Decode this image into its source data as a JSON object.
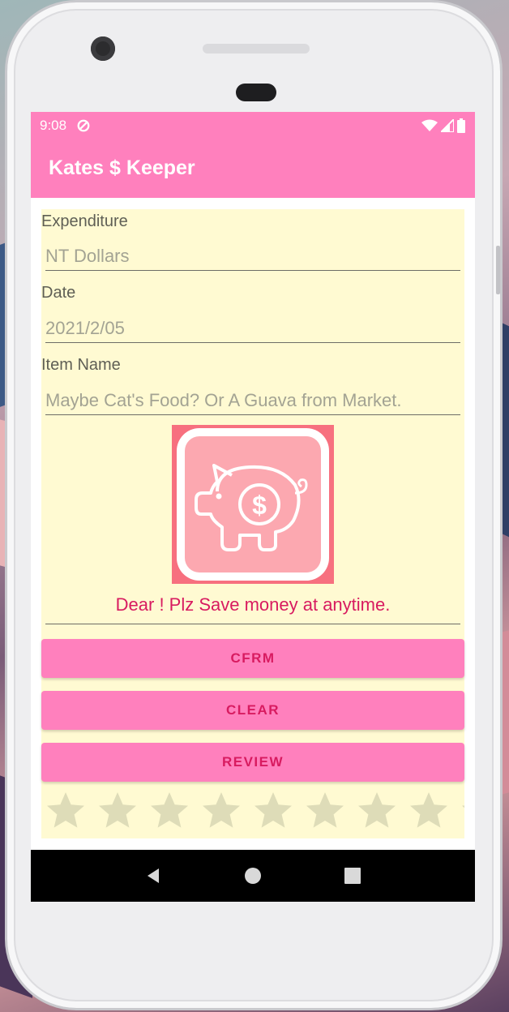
{
  "status_bar": {
    "time": "9:08",
    "icons": [
      "sync-icon",
      "wifi-icon",
      "signal-icon",
      "battery-icon"
    ]
  },
  "app_bar": {
    "title": "Kates $ Keeper"
  },
  "form": {
    "expenditure_label": "Expenditure",
    "expenditure_placeholder": "NT Dollars",
    "date_label": "Date",
    "date_placeholder": "2021/2/05",
    "item_label": "Item Name",
    "item_placeholder": "Maybe Cat's Food? Or A Guava from Market.",
    "motto": "Dear ! Plz Save money at anytime."
  },
  "buttons": {
    "confirm": "CFRM",
    "clear": "CLEAR",
    "review": "REVIEW"
  },
  "rating": {
    "value": 0
  },
  "nav": {
    "icons": [
      "back-icon",
      "home-icon",
      "recents-icon"
    ]
  },
  "colors": {
    "primary": "#ff80bd",
    "accent_text": "#d81b60",
    "form_background": "#fffad2",
    "star_empty": "#dedcb8"
  }
}
